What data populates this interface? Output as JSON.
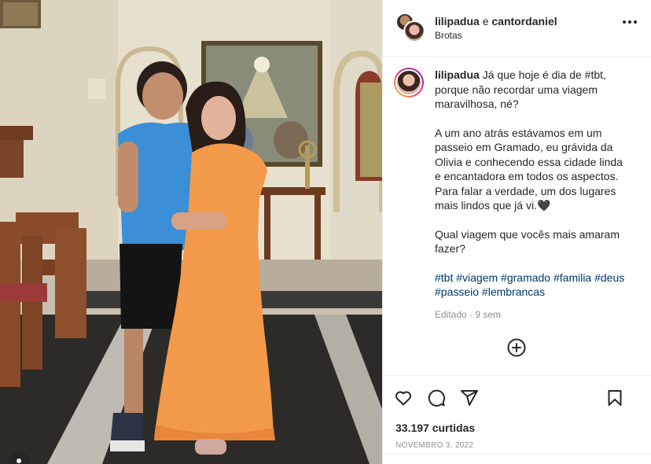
{
  "header": {
    "user1": "lilipadua",
    "connector": "e",
    "user2": "cantordaniel",
    "location": "Brotas"
  },
  "caption": {
    "username": "lilipadua",
    "line1": "Já que hoje é dia de #tbt, porque não recordar uma viagem maravilhosa, né?",
    "paragraph2": "A um ano atrás estávamos em um passeio em Gramado, eu grávida da Olivia e conhecendo essa cidade linda e encantadora em todos os aspectos. Para falar a verdade, um dos lugares mais lindos que já vi.🖤",
    "paragraph3": "Qual viagem que vocês mais amaram fazer?",
    "hashtags": "#tbt #viagem #gramado #familia #deus #passeio #lembrancas",
    "meta": "Editado · 9 sem"
  },
  "likes": "33.197 curtidas",
  "date": "NOVEMBRO 3, 2022",
  "icons": {
    "more": "more-horizontal-icon",
    "add_comment": "plus-circle-icon",
    "like": "heart-icon",
    "comment": "comment-icon",
    "share": "send-icon",
    "save": "bookmark-icon",
    "tag": "user-tag-icon"
  },
  "colors": {
    "link": "#00376b",
    "muted": "#8e8e8e",
    "text": "#262626",
    "dress": "#f39a4a",
    "shirt": "#3a8fd6"
  }
}
